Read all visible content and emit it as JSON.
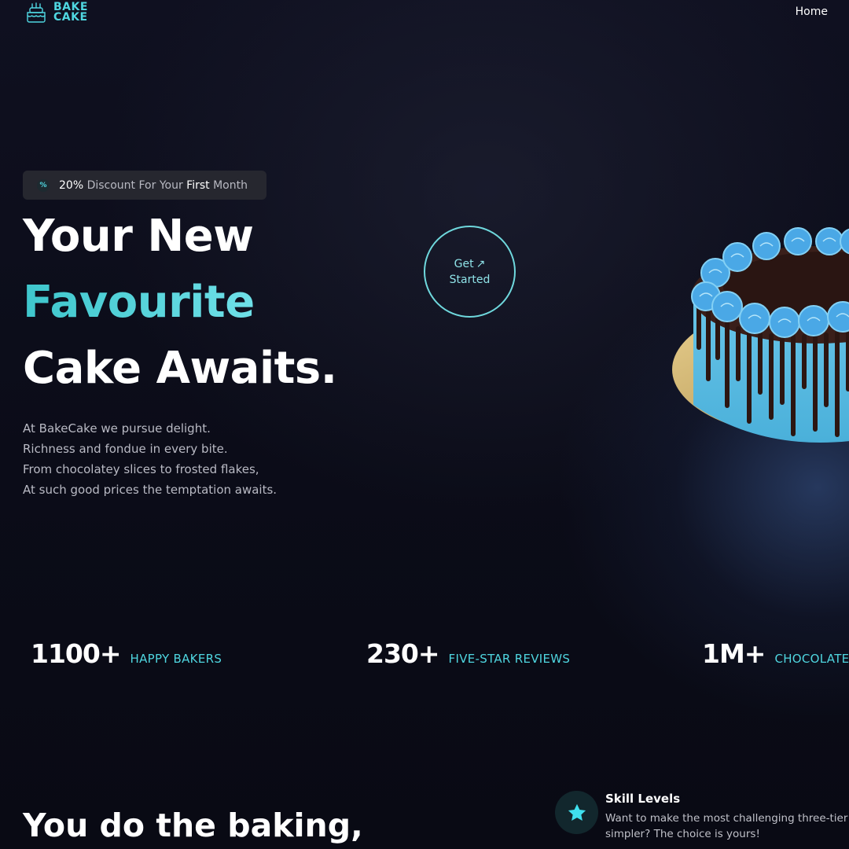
{
  "header": {
    "logo_line1": "BAKE",
    "logo_line2": "CAKE",
    "nav_home": "Home"
  },
  "promo": {
    "icon": "percent-icon",
    "lead": "20%",
    "mid": " Discount For Your ",
    "strong": "First",
    "tail": " Month"
  },
  "hero": {
    "line1": "Your New",
    "line2": "Favourite",
    "line3": "Cake Awaits.",
    "description": [
      "At BakeCake we pursue delight.",
      "Richness and fondue in every bite.",
      "From chocolatey slices to frosted flakes,",
      "At such good prices the temptation awaits."
    ],
    "cta_line1": "Get",
    "cta_arrow": "↗",
    "cta_line2": "Started"
  },
  "stats": [
    {
      "value": "1100+",
      "label": "HAPPY BAKERS"
    },
    {
      "value": "230+",
      "label": "FIVE-STAR REVIEWS"
    },
    {
      "value": "1M+",
      "label": "CHOCOLATE S"
    }
  ],
  "section2": {
    "title": "You do the baking,",
    "skill_title": "Skill Levels",
    "skill_text_line1": "Want to make the most challenging three-tier",
    "skill_text_line2": "simpler? The choice is yours!",
    "skill_icon": "star-icon"
  },
  "colors": {
    "accent": "#4fd6e0",
    "background": "#0b0c16",
    "badge_bg": "#26272f"
  }
}
